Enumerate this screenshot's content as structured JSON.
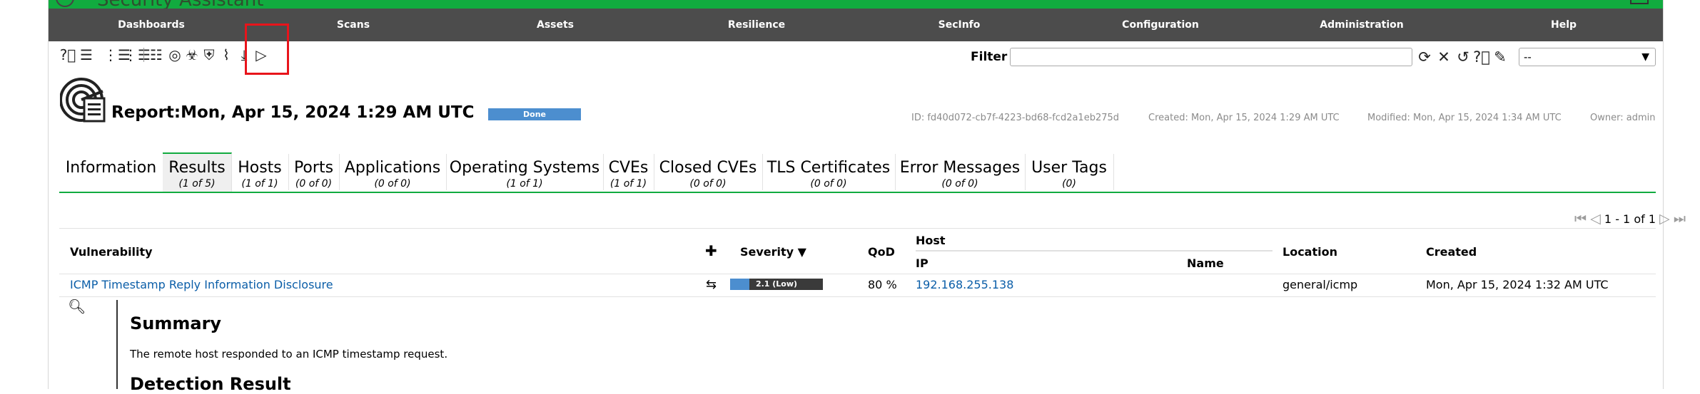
{
  "app": {
    "title": "Security Assistant"
  },
  "menu": {
    "items": [
      "Dashboards",
      "Scans",
      "Assets",
      "Resilience",
      "SecInfo",
      "Configuration",
      "Administration",
      "Help"
    ]
  },
  "toolbar": {
    "icons": [
      "help-icon",
      "list-icon",
      "delta-report-icon",
      "delta-report-alt-icon",
      "task-list-icon",
      "results-icon",
      "vulnerability-icon",
      "cert-icon",
      "tls-icon",
      "download-icon",
      "trigger-alert-icon"
    ]
  },
  "filter": {
    "label": "Filter",
    "value": "",
    "select_value": "--"
  },
  "report": {
    "title": "Report:Mon, Apr 15, 2024 1:29 AM UTC",
    "status": "Done",
    "id": "ID: fd40d072-cb7f-4223-bd68-fcd2a1eb275d",
    "created": "Created: Mon, Apr 15, 2024 1:29 AM UTC",
    "modified": "Modified: Mon, Apr 15, 2024 1:34 AM UTC",
    "owner": "Owner: admin"
  },
  "tabs": [
    {
      "label": "Information",
      "count": ""
    },
    {
      "label": "Results",
      "count": "(1 of 5)"
    },
    {
      "label": "Hosts",
      "count": "(1 of 1)"
    },
    {
      "label": "Ports",
      "count": "(0 of 0)"
    },
    {
      "label": "Applications",
      "count": "(0 of 0)"
    },
    {
      "label": "Operating Systems",
      "count": "(1 of 1)"
    },
    {
      "label": "CVEs",
      "count": "(1 of 1)"
    },
    {
      "label": "Closed CVEs",
      "count": "(0 of 0)"
    },
    {
      "label": "TLS Certificates",
      "count": "(0 of 0)"
    },
    {
      "label": "Error Messages",
      "count": "(0 of 0)"
    },
    {
      "label": "User Tags",
      "count": "(0)"
    }
  ],
  "pagination": {
    "text": "1 - 1 of 1"
  },
  "results_table": {
    "headers": {
      "vulnerability": "Vulnerability",
      "severity": "Severity ▼",
      "qod": "QoD",
      "host": "Host",
      "ip": "IP",
      "name": "Name",
      "location": "Location",
      "created": "Created"
    },
    "rows": [
      {
        "vulnerability": "ICMP Timestamp Reply Information Disclosure",
        "severity_label": "2.1 (Low)",
        "severity_value": 2.1,
        "qod": "80 %",
        "ip": "192.168.255.138",
        "name": "",
        "location": "general/icmp",
        "created": "Mon, Apr 15, 2024 1:32 AM UTC"
      }
    ]
  },
  "details": {
    "summary_heading": "Summary",
    "summary_text": "The remote host responded to an ICMP timestamp request.",
    "detection_heading": "Detection Result"
  },
  "colors": {
    "brand_green": "#11ab3f",
    "menu_bg": "#4c4c4c",
    "severity_low": "#4c8ecf",
    "link": "#0b5ea8",
    "highlight": "#e8141b"
  }
}
